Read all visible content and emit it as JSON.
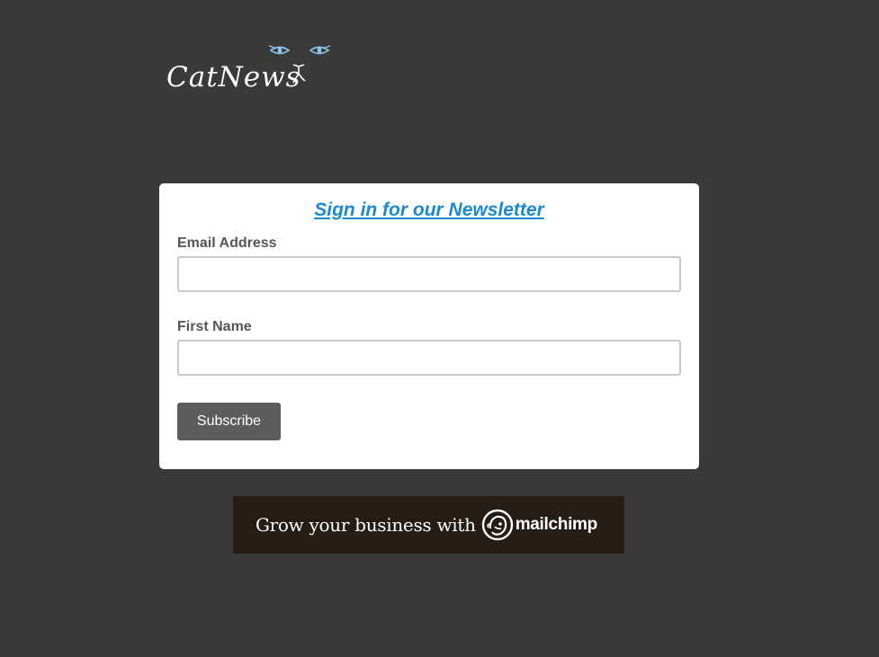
{
  "logo": {
    "text": "CatNews",
    "icon": "cat-eyes-icon",
    "eye_color": "#8fc8f0"
  },
  "form": {
    "title": "Sign in for our Newsletter",
    "email_label": "Email Address",
    "email_value": "",
    "first_name_label": "First Name",
    "first_name_value": "",
    "submit_label": "Subscribe"
  },
  "banner": {
    "text": "Grow your business with",
    "brand": "mailchimp",
    "icon": "mailchimp-freddie-icon"
  },
  "colors": {
    "page_background": "#3a3a3a",
    "card_background": "#ffffff",
    "title_link": "#1a8ad0",
    "button_background": "#5d5d5d",
    "banner_background": "#241c15"
  }
}
